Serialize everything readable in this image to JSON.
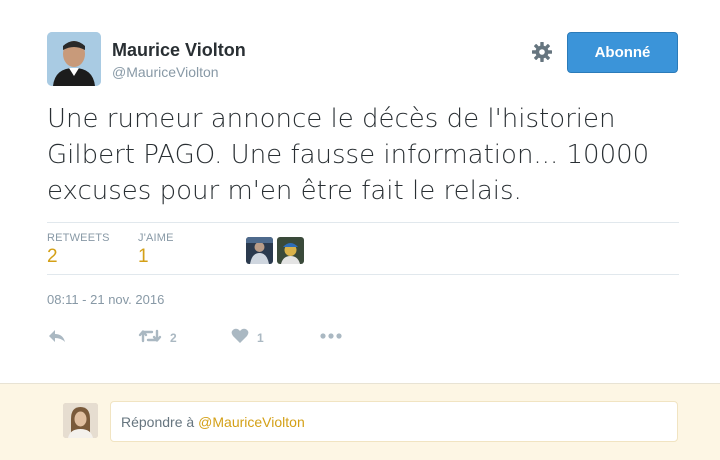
{
  "tweet": {
    "author_name": "Maurice Violton",
    "author_handle": "@MauriceViolton",
    "follow_label": "Abonné",
    "text_lines": [
      "Une rumeur annonce le décès de l'historien",
      "Gilbert PAGO. Une fausse information... 10000",
      "excuses pour m'en être fait le relais."
    ],
    "stats": {
      "retweets_label": "RETWEETS",
      "retweets_value": "2",
      "likes_label": "J'AIME",
      "likes_value": "1"
    },
    "timestamp": "08:11 - 21 nov. 2016",
    "actions": {
      "retweet_count": "2",
      "like_count": "1"
    }
  },
  "reply": {
    "prefix": "Répondre à",
    "mention": "@MauriceViolton"
  },
  "icons": [
    "gear-icon",
    "reply-icon",
    "retweet-icon",
    "heart-icon",
    "more-icon"
  ],
  "colors": {
    "follow_button": "#3b94d9",
    "stat_value": "#d4a017",
    "mention": "#d4a017",
    "muted": "#8899a6",
    "reply_bar": "#fdf6e4"
  }
}
